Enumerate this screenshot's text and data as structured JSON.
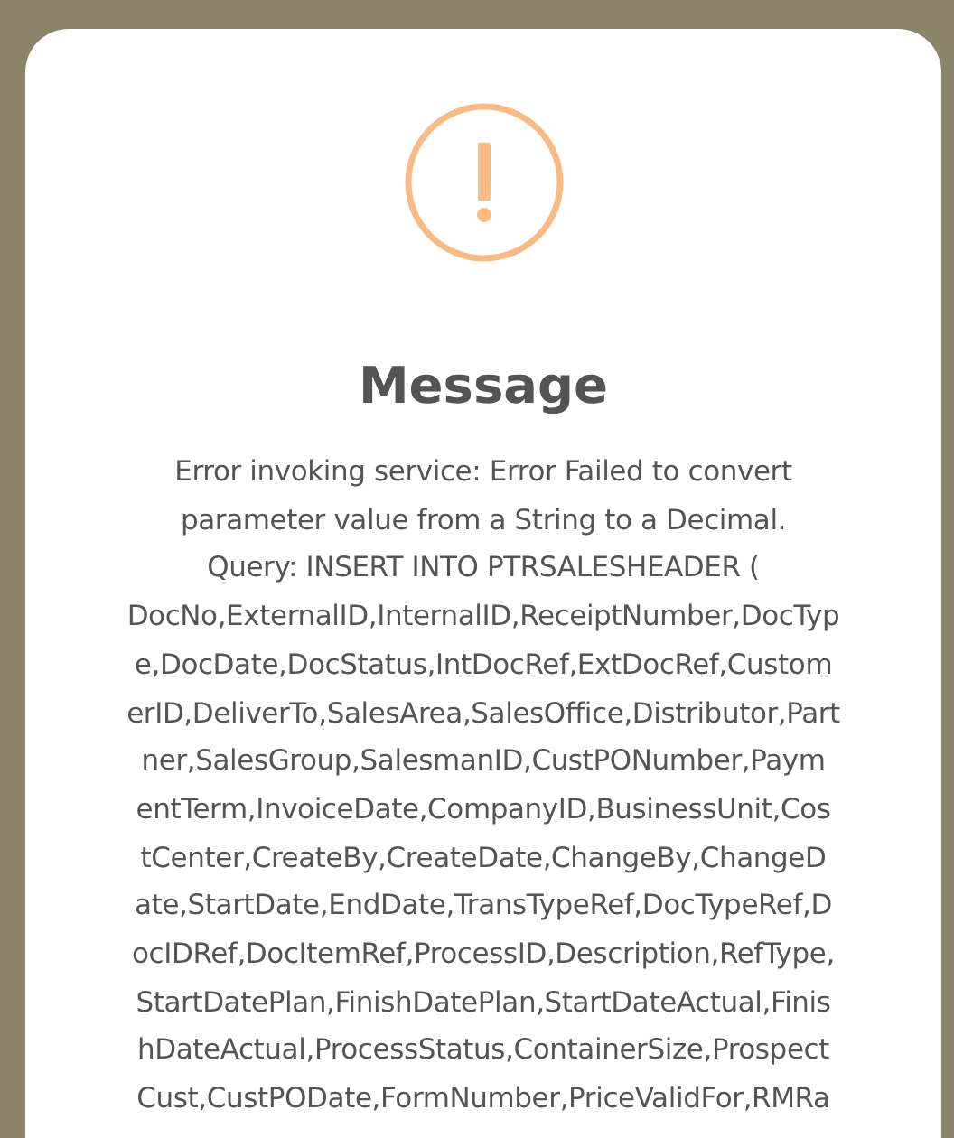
{
  "dialog": {
    "title": "Message",
    "message_lines": [
      "Error invoking service: Error Failed to convert",
      "parameter value from a String to a Decimal.",
      "Query: INSERT INTO PTRSALESHEADER (",
      "DocNo,ExternalID,InternalID,ReceiptNumber,DocTyp",
      "e,DocDate,DocStatus,IntDocRef,ExtDocRef,Custom",
      "erID,DeliverTo,SalesArea,SalesOffice,Distributor,Part",
      "ner,SalesGroup,SalesmanID,CustPONumber,Paym",
      "entTerm,InvoiceDate,CompanyID,BusinessUnit,Cos",
      "tCenter,CreateBy,CreateDate,ChangeBy,ChangeD",
      "ate,StartDate,EndDate,TransTypeRef,DocTypeRef,D",
      "ocIDRef,DocItemRef,ProcessID,Description,RefType,",
      "StartDatePlan,FinishDatePlan,StartDateActual,Finis",
      "hDateActual,ProcessStatus,ContainerSize,Prospect",
      "Cust,CustPODate,FormNumber,PriceValidFor,RMRa"
    ]
  }
}
